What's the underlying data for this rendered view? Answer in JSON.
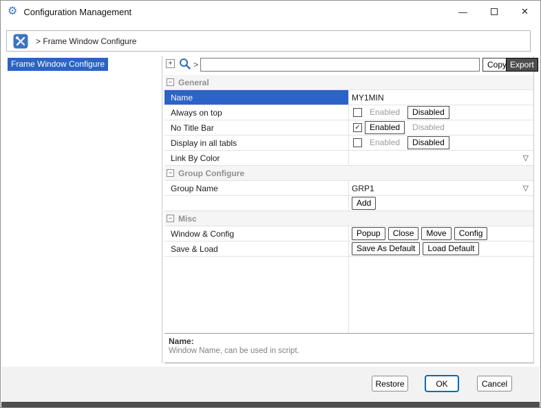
{
  "titlebar": {
    "title": "Configuration Management",
    "icons": {
      "app": "⚙",
      "minimize": "—",
      "close": "✕"
    }
  },
  "breadcrumb": {
    "text": "> Frame Window Configure"
  },
  "sidebar": {
    "items": [
      {
        "label": "Frame Window Configure",
        "selected": true
      }
    ]
  },
  "toolbar": {
    "expand_label": "+",
    "search_prefix": ">",
    "search_value": "",
    "copy_label": "Copy",
    "export_label": "Export"
  },
  "grid": {
    "sections": {
      "general": {
        "toggle": "−",
        "title": "General",
        "rows": {
          "name": {
            "label": "Name",
            "value": "MY1MIN"
          },
          "always_on_top": {
            "label": "Always on top",
            "checked": false,
            "check_glyph": "",
            "enabled_label": "Enabled",
            "disabled_label": "Disabled",
            "state": "disabled"
          },
          "no_title_bar": {
            "label": "No Title Bar",
            "checked": true,
            "check_glyph": "✓",
            "enabled_label": "Enabled",
            "disabled_label": "Disabled",
            "state": "enabled"
          },
          "display_all_tabs": {
            "label": "Display in all tabls",
            "checked": false,
            "check_glyph": "",
            "enabled_label": "Enabled",
            "disabled_label": "Disabled",
            "state": "disabled"
          },
          "link_by_color": {
            "label": "Link By Color",
            "dropdown_glyph": "▽"
          }
        }
      },
      "group_configure": {
        "toggle": "−",
        "title": "Group Configure",
        "rows": {
          "group_name": {
            "label": "Group Name",
            "value": "GRP1",
            "dropdown_glyph": "▽"
          },
          "add": {
            "button_label": "Add"
          }
        }
      },
      "misc": {
        "toggle": "−",
        "title": "Misc",
        "rows": {
          "window_config": {
            "label": "Window & Config",
            "buttons": [
              "Popup",
              "Close",
              "Move",
              "Config"
            ]
          },
          "save_load": {
            "label": "Save & Load",
            "buttons": [
              "Save As Default",
              "Load Default"
            ]
          }
        }
      }
    },
    "description": {
      "title": "Name:",
      "text": "Window Name, can be used in script."
    }
  },
  "footer": {
    "restore_label": "Restore",
    "ok_label": "OK",
    "cancel_label": "Cancel"
  }
}
